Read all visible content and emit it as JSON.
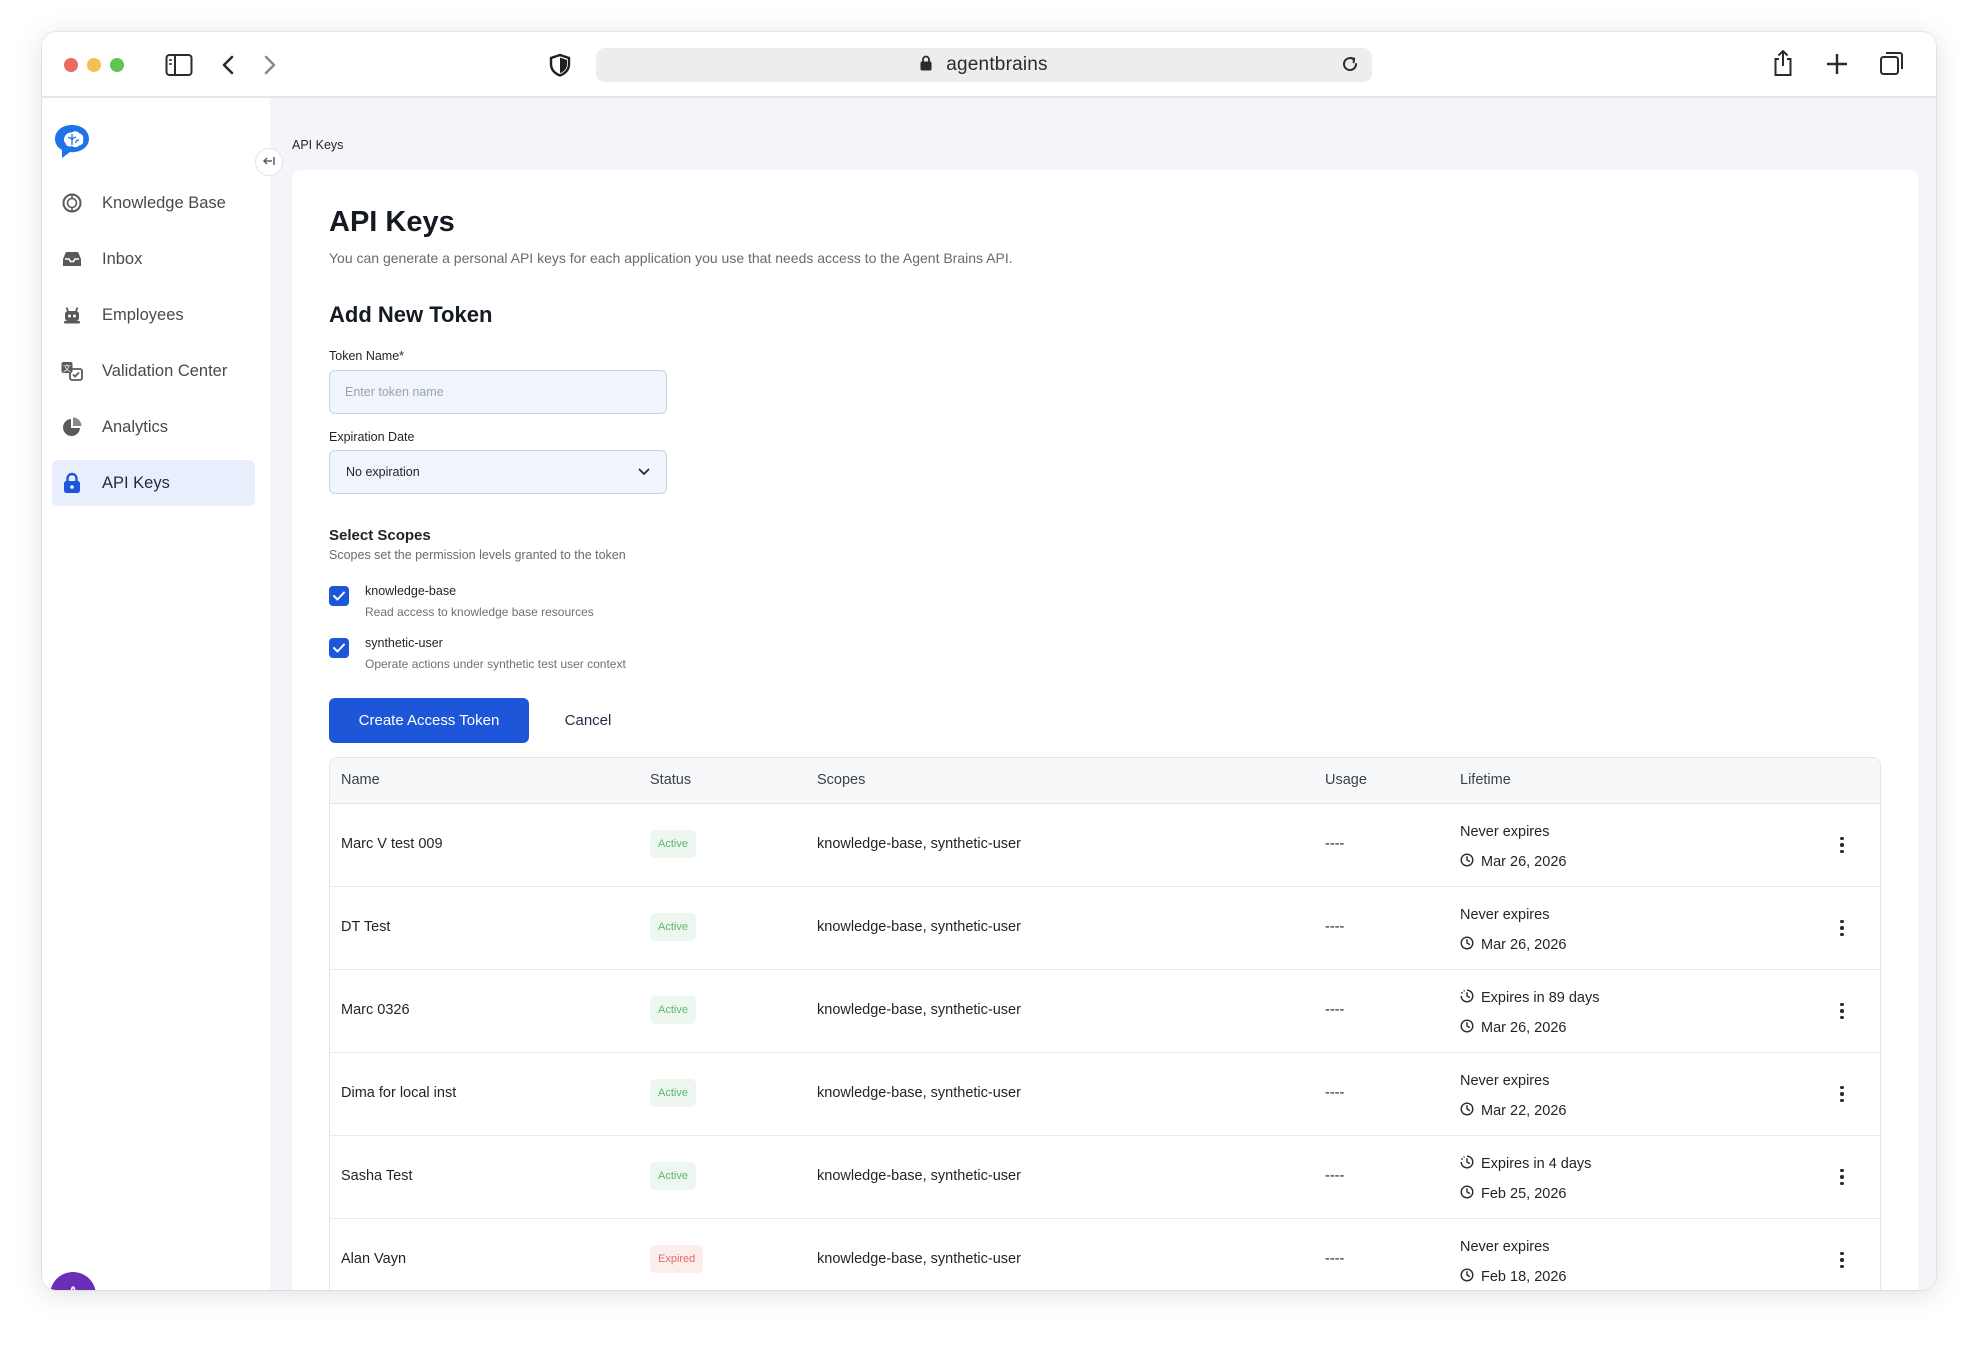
{
  "browser": {
    "address": "agentbrains",
    "icons": [
      "sidebar-toggle-icon",
      "back-icon",
      "forward-icon",
      "shield-icon",
      "lock-icon",
      "reload-icon",
      "share-icon",
      "new-tab-icon",
      "tabs-icon"
    ]
  },
  "sidebar": {
    "items": [
      {
        "label": "Knowledge Base",
        "icon": "knowledge-base-icon"
      },
      {
        "label": "Inbox",
        "icon": "inbox-icon"
      },
      {
        "label": "Employees",
        "icon": "employees-icon"
      },
      {
        "label": "Validation Center",
        "icon": "validation-icon"
      },
      {
        "label": "Analytics",
        "icon": "analytics-icon"
      },
      {
        "label": "API Keys",
        "icon": "lock-icon",
        "active": true
      }
    ],
    "avatar": "A"
  },
  "breadcrumb": "API Keys",
  "page": {
    "title": "API Keys",
    "subtitle": "You can generate a personal API keys for each application you use that needs access to the Agent Brains API."
  },
  "form": {
    "section_title": "Add New Token",
    "token_name_label": "Token Name*",
    "token_name_placeholder": "Enter token name",
    "token_name_value": "",
    "expiration_label": "Expiration Date",
    "expiration_value": "No expiration",
    "scopes_title": "Select Scopes",
    "scopes_subtitle": "Scopes set the permission levels granted to the token",
    "scopes": [
      {
        "name": "knowledge-base",
        "description": "Read access to knowledge base resources",
        "checked": true
      },
      {
        "name": "synthetic-user",
        "description": "Operate actions under synthetic test user context",
        "checked": true
      }
    ],
    "create_label": "Create Access Token",
    "cancel_label": "Cancel"
  },
  "table": {
    "columns": [
      "Name",
      "Status",
      "Scopes",
      "Usage",
      "Lifetime"
    ],
    "rows": [
      {
        "name": "Marc V test 009",
        "status": "Active",
        "status_type": "active",
        "scopes": "knowledge-base, synthetic-user",
        "usage": "----",
        "expiry": "Never expires",
        "expiry_icon": "",
        "date": "Mar 26, 2026"
      },
      {
        "name": "DT Test",
        "status": "Active",
        "status_type": "active",
        "scopes": "knowledge-base, synthetic-user",
        "usage": "----",
        "expiry": "Never expires",
        "expiry_icon": "",
        "date": "Mar 26, 2026"
      },
      {
        "name": "Marc 0326",
        "status": "Active",
        "status_type": "active",
        "scopes": "knowledge-base, synthetic-user",
        "usage": "----",
        "expiry": "Expires in 89 days",
        "expiry_icon": "clock-dashed-icon",
        "date": "Mar 26, 2026"
      },
      {
        "name": "Dima for local inst",
        "status": "Active",
        "status_type": "active",
        "scopes": "knowledge-base, synthetic-user",
        "usage": "----",
        "expiry": "Never expires",
        "expiry_icon": "",
        "date": "Mar 22, 2026"
      },
      {
        "name": "Sasha Test",
        "status": "Active",
        "status_type": "active",
        "scopes": "knowledge-base, synthetic-user",
        "usage": "----",
        "expiry": "Expires in 4 days",
        "expiry_icon": "clock-dashed-icon",
        "date": "Feb 25, 2026"
      },
      {
        "name": "Alan Vayn",
        "status": "Expired",
        "status_type": "expired",
        "scopes": "knowledge-base, synthetic-user",
        "usage": "----",
        "expiry": "Never expires",
        "expiry_icon": "",
        "date": "Feb 18, 2026"
      }
    ]
  },
  "colors": {
    "accent": "#1e56d9",
    "active_badge": "#5ab86c",
    "expired_badge": "#e06a6a",
    "avatar": "#6a2fb6"
  }
}
